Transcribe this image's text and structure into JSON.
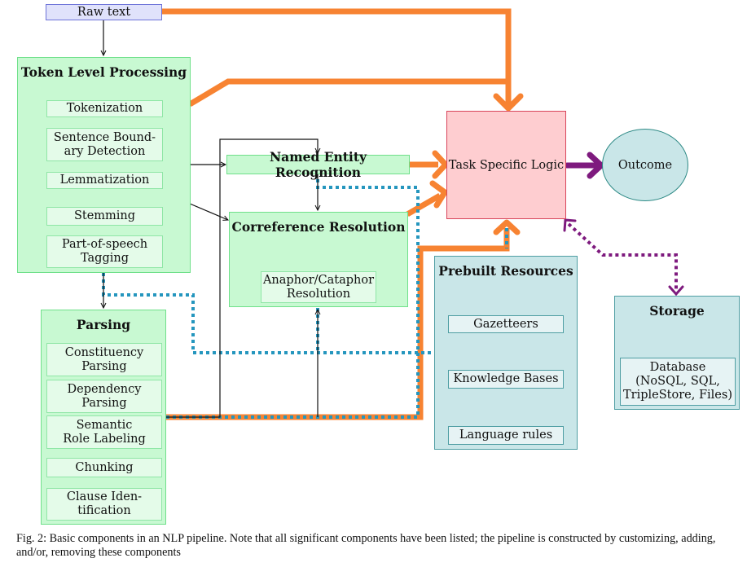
{
  "nodes": {
    "raw_text": "Raw text",
    "token_level": {
      "title": "Token Level Processing",
      "items": [
        "Tokenization",
        "Sentence Bound-\nary Detection",
        "Lemmatization",
        "Stemming",
        "Part-of-speech\nTagging"
      ]
    },
    "parsing": {
      "title": "Parsing",
      "items": [
        "Constituency\nParsing",
        "Dependency\nParsing",
        "Semantic\nRole Labeling",
        "Chunking",
        "Clause Iden-\ntification"
      ]
    },
    "ner": "Named Entity Recognition",
    "coref": {
      "title": "Correference Resolution",
      "items": [
        "Anaphor/Cataphor\nResolution"
      ]
    },
    "task_logic": "Task Specific Logic",
    "outcome": "Outcome",
    "prebuilt": {
      "title": "Prebuilt Resources",
      "items": [
        "Gazetteers",
        "Knowledge Bases",
        "Language rules"
      ]
    },
    "storage": {
      "title": "Storage",
      "items": [
        "Database\n(NoSQL, SQL,\nTripleStore, Files)"
      ]
    }
  },
  "edges": [
    {
      "from": "raw_text",
      "to": "token_level",
      "style": "thin-black"
    },
    {
      "from": "raw_text",
      "to": "task_logic",
      "style": "thick-orange"
    },
    {
      "from": "token_level",
      "to": "task_logic",
      "style": "thick-orange"
    },
    {
      "from": "token_level",
      "to": "ner",
      "style": "thin-black"
    },
    {
      "from": "token_level",
      "to": "coref",
      "style": "thin-black"
    },
    {
      "from": "token_level",
      "to": "parsing",
      "style": "thin-black"
    },
    {
      "from": "ner",
      "to": "coref",
      "style": "thin-black"
    },
    {
      "from": "ner",
      "to": "task_logic",
      "style": "thick-orange"
    },
    {
      "from": "coref",
      "to": "task_logic",
      "style": "thick-orange"
    },
    {
      "from": "parsing",
      "to": "ner",
      "style": "thin-black"
    },
    {
      "from": "parsing",
      "to": "coref",
      "style": "thin-black"
    },
    {
      "from": "parsing",
      "to": "task_logic",
      "style": "thick-orange"
    },
    {
      "from": "prebuilt",
      "to": "token_level",
      "style": "dotted-blue"
    },
    {
      "from": "prebuilt",
      "to": "ner",
      "style": "dotted-blue"
    },
    {
      "from": "prebuilt",
      "to": "coref",
      "style": "dotted-blue"
    },
    {
      "from": "prebuilt",
      "to": "parsing",
      "style": "dotted-blue"
    },
    {
      "from": "prebuilt",
      "to": "task_logic",
      "style": "dotted-blue"
    },
    {
      "from": "task_logic",
      "to": "outcome",
      "style": "thick-purple"
    },
    {
      "from": "task_logic",
      "to": "storage",
      "style": "dotted-purple-bidirectional"
    }
  ],
  "colors": {
    "orange": "#f78332",
    "blue_dotted": "#2596be",
    "purple": "#7e1a7e",
    "green_fill": "#c8f9d2",
    "teal_fill": "#c9e6e8",
    "pink_fill": "#fecdd0",
    "lavender_fill": "#e0e2fb"
  },
  "caption": "Fig. 2: Basic components in an NLP pipeline. Note that all significant components have been listed; the pipeline is constructed by customizing, adding, and/or, removing these components"
}
